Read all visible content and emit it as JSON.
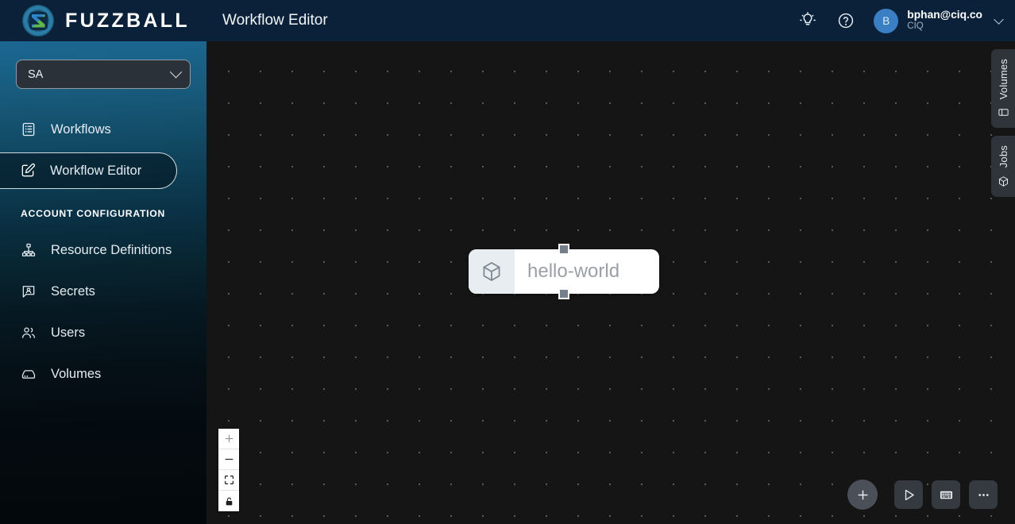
{
  "brand": {
    "name": "FUZZBALL",
    "logo_icon": "fuzzball-logo-icon"
  },
  "sidebar": {
    "org_select": {
      "value": "SA",
      "chevron_icon": "chevron-down-icon"
    },
    "primary_items": [
      {
        "label": "Workflows",
        "icon": "list-document-icon",
        "active": false
      },
      {
        "label": "Workflow Editor",
        "icon": "pencil-square-icon",
        "active": true
      }
    ],
    "section_label": "ACCOUNT CONFIGURATION",
    "config_items": [
      {
        "label": "Resource Definitions",
        "icon": "sitemap-icon"
      },
      {
        "label": "Secrets",
        "icon": "secret-badge-icon"
      },
      {
        "label": "Users",
        "icon": "users-icon"
      },
      {
        "label": "Volumes",
        "icon": "drive-icon"
      }
    ]
  },
  "header": {
    "title": "Workflow Editor",
    "lightbulb_icon": "lightbulb-icon",
    "help_icon": "question-circle-icon",
    "user": {
      "avatar_initial": "B",
      "email": "bphan@ciq.co",
      "org": "CIQ",
      "chevron_icon": "chevron-down-icon"
    }
  },
  "canvas": {
    "node": {
      "label": "hello-world",
      "icon": "cube-icon",
      "handle_top": "connection-handle-top",
      "handle_bottom": "connection-handle-bottom"
    },
    "zoom_controls": [
      {
        "name": "zoom-in-button",
        "icon": "plus-icon"
      },
      {
        "name": "zoom-out-button",
        "icon": "minus-icon"
      },
      {
        "name": "fit-view-button",
        "icon": "fit-frame-icon"
      },
      {
        "name": "lock-toggle-button",
        "icon": "unlock-icon"
      }
    ],
    "toolbar": [
      {
        "name": "add-node-button",
        "icon": "plus-icon"
      },
      {
        "name": "run-workflow-button",
        "icon": "play-icon"
      },
      {
        "name": "keyboard-shortcuts-button",
        "icon": "keyboard-icon"
      },
      {
        "name": "more-options-button",
        "icon": "ellipsis-icon"
      }
    ]
  },
  "side_panels": [
    {
      "label": "Volumes",
      "icon": "drive-icon"
    },
    {
      "label": "Jobs",
      "icon": "hexagon-cube-icon"
    }
  ],
  "colors": {
    "brand_header": "#0b2139",
    "sidebar_top": "#1d6d9b",
    "sidebar_bottom": "#03080c",
    "canvas_bg": "#151515",
    "avatar_blue": "#3a7fc4",
    "node_white": "#ffffff",
    "node_icon_bg": "#e8edf1",
    "toolbar_btn": "#343a40"
  }
}
